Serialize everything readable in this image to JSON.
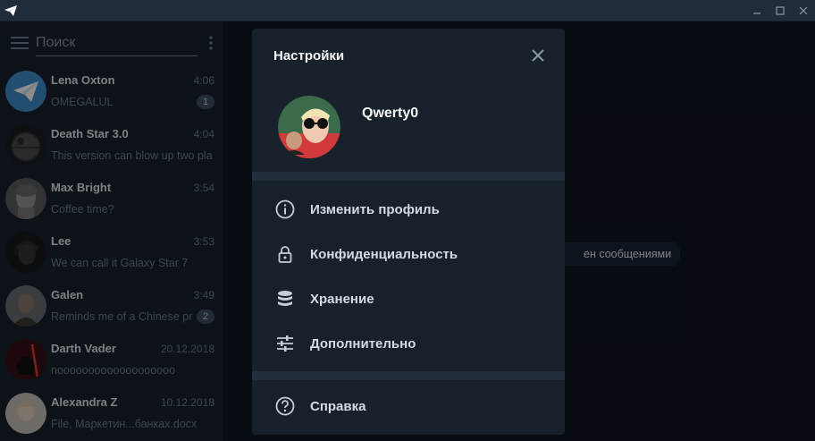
{
  "colors": {
    "app_bg": "#0e1621",
    "panel_bg": "#17212b",
    "accent": "#5288c1",
    "muted_text": "#6f8194",
    "badge_bg": "#3f5061"
  },
  "titlebar": {
    "logo_icon": "paper-plane-icon",
    "controls": [
      "minimize-icon",
      "maximize-icon",
      "close-icon"
    ]
  },
  "search": {
    "placeholder": "Поиск",
    "value": ""
  },
  "chats": [
    {
      "name": "Lena Oxton",
      "time": "4:06",
      "message": "OMEGALUL",
      "badge": "1"
    },
    {
      "name": "Death Star 3.0",
      "time": "4:04",
      "message": "This version can blow up two pla",
      "badge": ""
    },
    {
      "name": "Max Bright",
      "time": "3:54",
      "message": "Coffee time?",
      "badge": ""
    },
    {
      "name": "Lee",
      "time": "3:53",
      "message": "We can call it Galaxy Star 7",
      "badge": ""
    },
    {
      "name": "Galen",
      "time": "3:49",
      "message": "Reminds me of a Chinese pro",
      "badge": "2"
    },
    {
      "name": "Darth Vader",
      "time": "20.12.2018",
      "message": "nooooooooooooooooooo",
      "badge": ""
    },
    {
      "name": "Alexandra Z",
      "time": "10.12.2018",
      "message": "File, Маркетин...банках.docx",
      "badge": ""
    }
  ],
  "main": {
    "hint": "ен сообщениями"
  },
  "settings": {
    "title": "Настройки",
    "profile_name": "Qwerty0",
    "menu": [
      {
        "label": "Изменить профиль",
        "icon": "info-icon"
      },
      {
        "label": "Конфиденциальность",
        "icon": "lock-icon"
      },
      {
        "label": "Хранение",
        "icon": "database-icon"
      },
      {
        "label": "Дополнительно",
        "icon": "sliders-icon"
      }
    ],
    "help": {
      "label": "Справка",
      "icon": "help-icon"
    }
  }
}
